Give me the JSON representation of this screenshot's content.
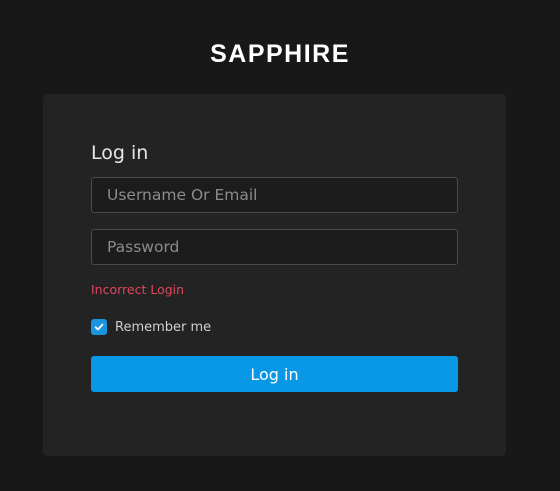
{
  "brand": {
    "logo_text": "SAPPHIRE"
  },
  "login_form": {
    "title": "Log in",
    "username_placeholder": "Username Or Email",
    "password_placeholder": "Password",
    "error_message": "Incorrect Login",
    "remember_me": {
      "label": "Remember me",
      "checked": true
    },
    "submit_label": "Log in"
  },
  "colors": {
    "background": "#181818",
    "card": "#232323",
    "accent": "#0898e6",
    "error": "#e0455c"
  }
}
